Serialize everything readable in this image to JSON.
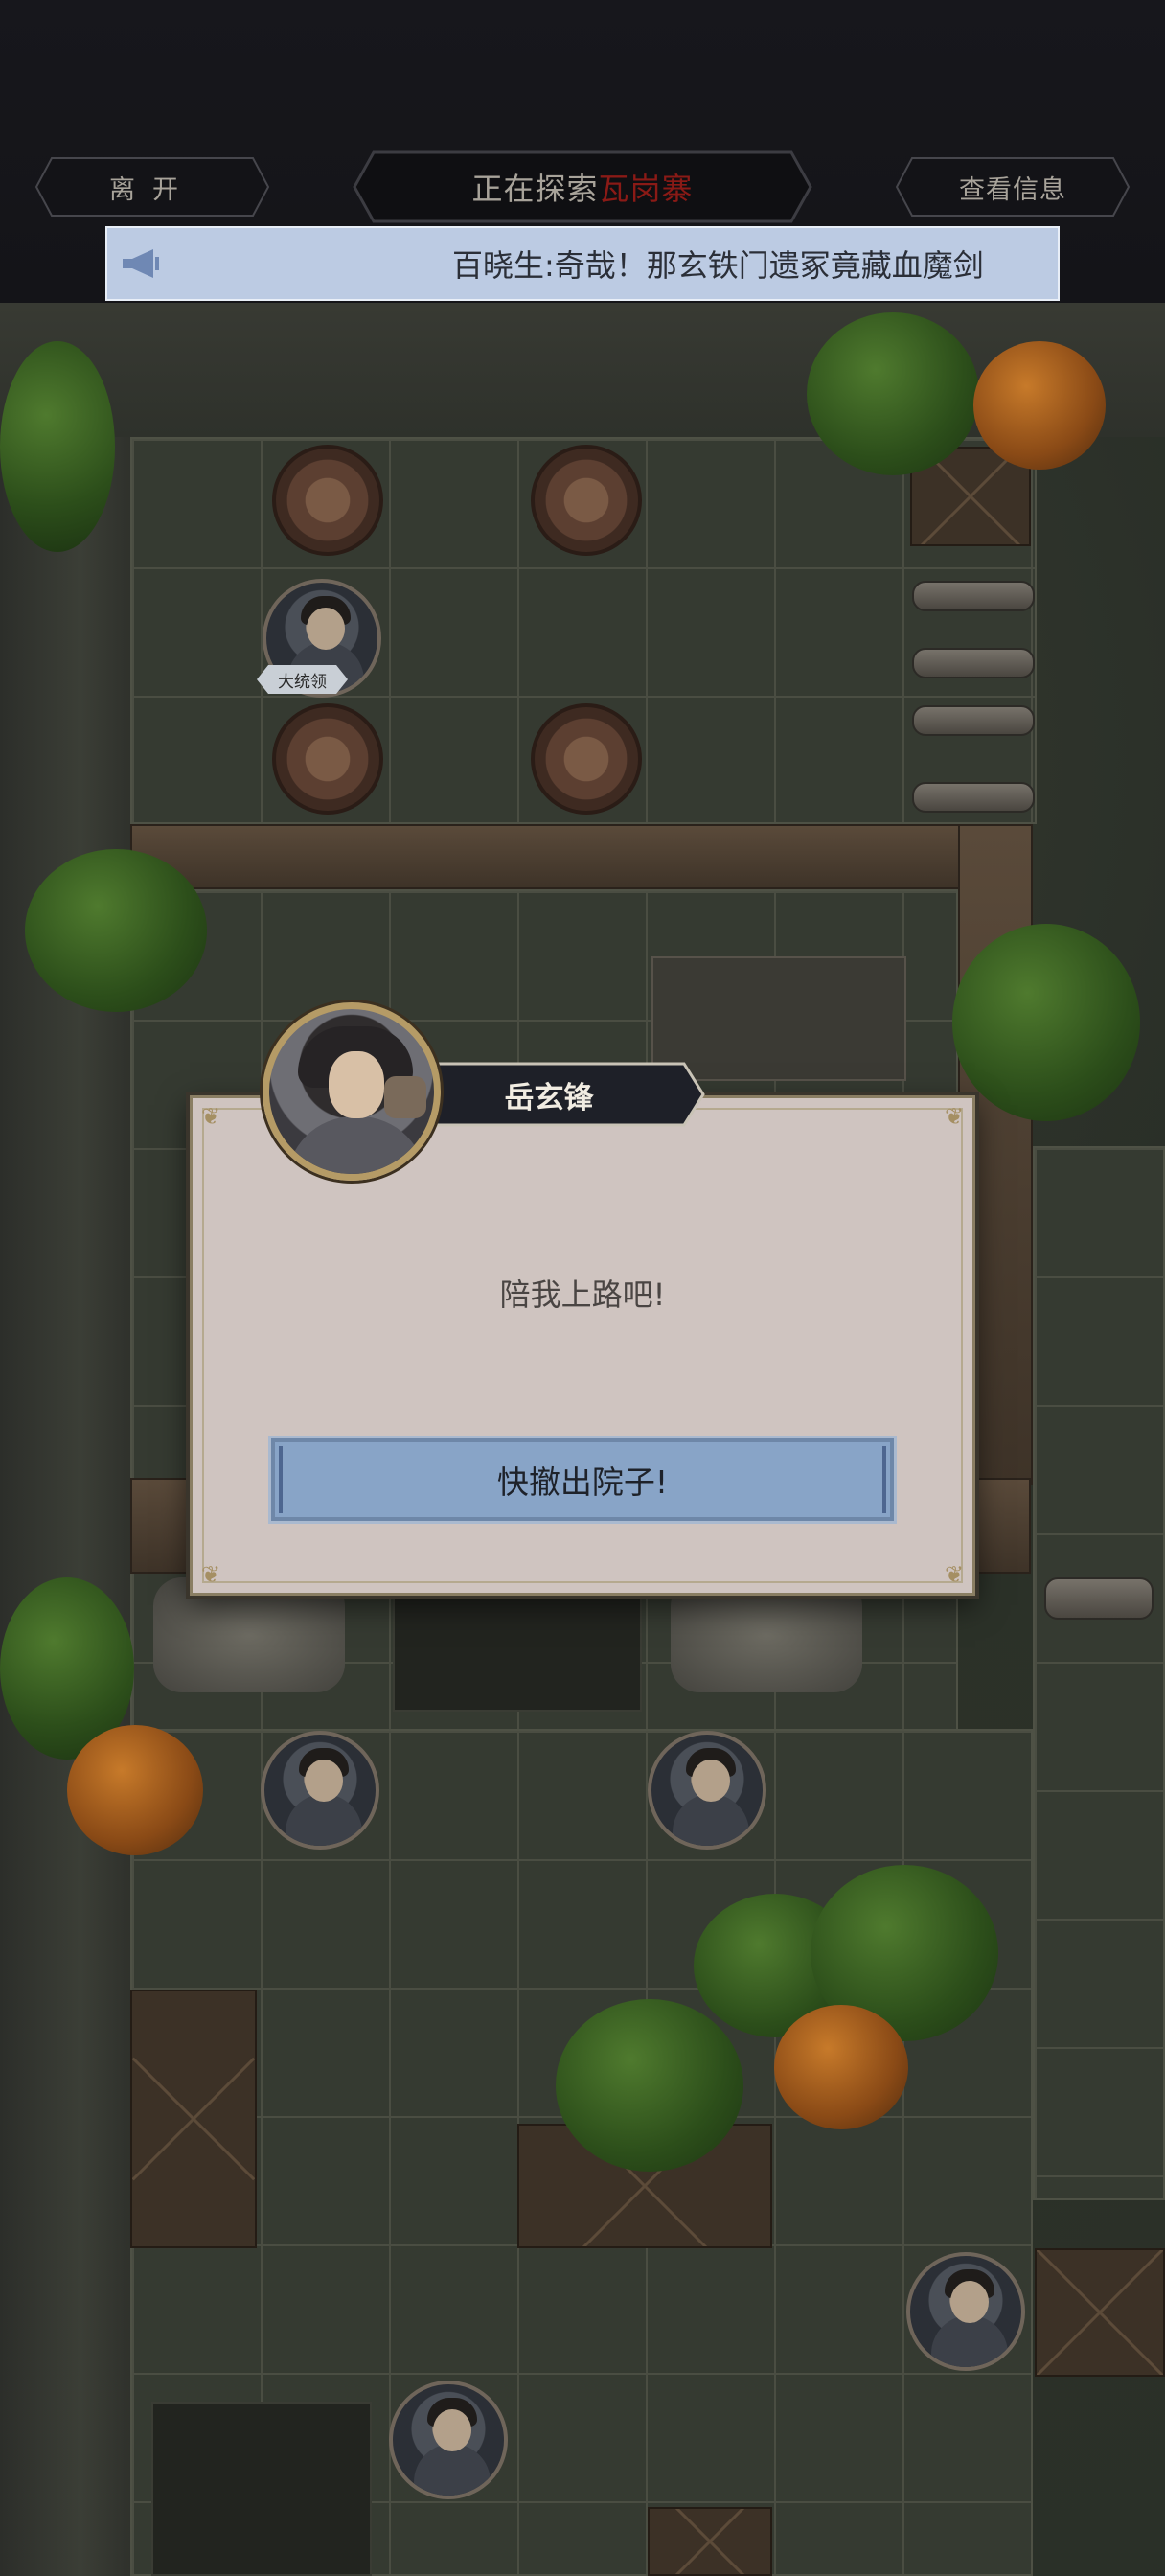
{
  "header": {
    "leave_label": "离开",
    "exploring_prefix": "正在探索",
    "location": "瓦岗寨",
    "view_info_label": "查看信息"
  },
  "ticker": {
    "icon": "megaphone-icon",
    "message": "百晓生:奇哉！那玄铁门遗冢竟藏血魔剑"
  },
  "map": {
    "npc_tags": [
      {
        "label": "大统领"
      }
    ]
  },
  "dialog": {
    "speaker": "岳玄锋",
    "text": "陪我上路吧!",
    "action_label": "快撤出院子!"
  },
  "colors": {
    "location_red": "#8a1a16",
    "ticker_bg": "#bccbe3",
    "dialog_bg": "#cfc4c0",
    "action_btn": "#88a4c7"
  }
}
